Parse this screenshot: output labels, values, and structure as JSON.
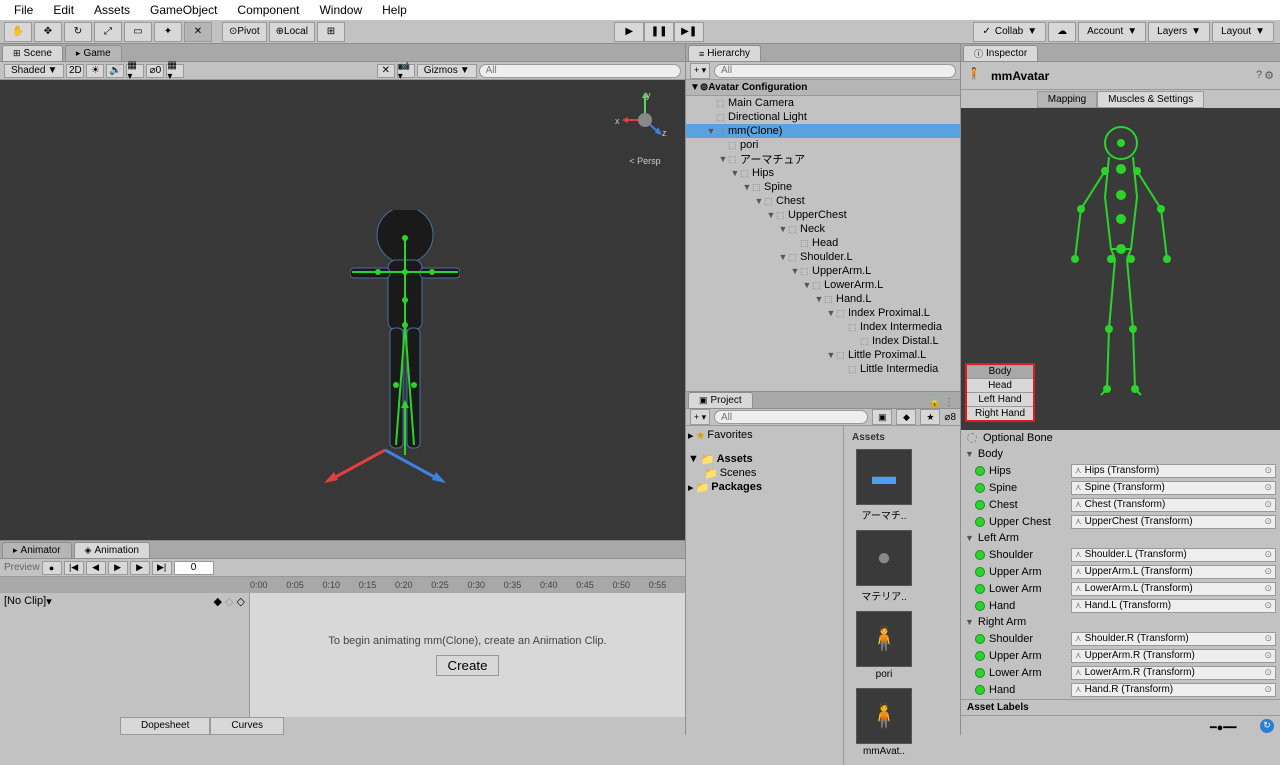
{
  "menu": {
    "file": "File",
    "edit": "Edit",
    "assets": "Assets",
    "gameObject": "GameObject",
    "component": "Component",
    "window": "Window",
    "help": "Help"
  },
  "toolbar": {
    "pivot": "Pivot",
    "local": "Local",
    "collab": "Collab",
    "account": "Account",
    "layers": "Layers",
    "layout": "Layout"
  },
  "tabs": {
    "scene": "Scene",
    "game": "Game",
    "hierarchy": "Hierarchy",
    "project": "Project",
    "inspector": "Inspector",
    "animator": "Animator",
    "animation": "Animation"
  },
  "sceneHdr": {
    "shaded": "Shaded",
    "mode2d": "2D",
    "gizmos": "Gizmos",
    "allPlaceholder": "All",
    "persp": "Persp",
    "x": "x",
    "y": "y",
    "z": "z"
  },
  "hier": {
    "section": "Avatar Configuration",
    "items": [
      {
        "l": 1,
        "n": "Main Camera"
      },
      {
        "l": 1,
        "n": "Directional Light"
      },
      {
        "l": 1,
        "n": "mm(Clone)",
        "f": true,
        "sel": true
      },
      {
        "l": 2,
        "n": "pori"
      },
      {
        "l": 2,
        "n": "アーマチュア",
        "f": true
      },
      {
        "l": 3,
        "n": "Hips",
        "f": true
      },
      {
        "l": 4,
        "n": "Spine",
        "f": true
      },
      {
        "l": 5,
        "n": "Chest",
        "f": true
      },
      {
        "l": 6,
        "n": "UpperChest",
        "f": true
      },
      {
        "l": 7,
        "n": "Neck",
        "f": true
      },
      {
        "l": 8,
        "n": "Head"
      },
      {
        "l": 7,
        "n": "Shoulder.L",
        "f": true
      },
      {
        "l": 8,
        "n": "UpperArm.L",
        "f": true
      },
      {
        "l": 9,
        "n": "LowerArm.L",
        "f": true
      },
      {
        "l": 10,
        "n": "Hand.L",
        "f": true
      },
      {
        "l": 11,
        "n": "Index Proximal.L",
        "f": true
      },
      {
        "l": 12,
        "n": "Index Intermedia"
      },
      {
        "l": 13,
        "n": "Index Distal.L"
      },
      {
        "l": 11,
        "n": "Little Proximal.L",
        "f": true
      },
      {
        "l": 12,
        "n": "Little Intermedia"
      }
    ]
  },
  "project": {
    "allPlaceholder": "All",
    "count": "8",
    "favorites": "Favorites",
    "assets": "Assets",
    "scenes": "Scenes",
    "packages": "Packages",
    "gridHdr": "Assets",
    "items": [
      "アーマチ..",
      "マテリア..",
      "pori",
      "mmAvat.."
    ]
  },
  "anim": {
    "preview": "Preview",
    "frame": "0",
    "noclip": "[No Clip]",
    "ticks": [
      "0:00",
      "0:05",
      "0:10",
      "0:15",
      "0:20",
      "0:25",
      "0:30",
      "0:35",
      "0:40",
      "0:45",
      "0:50",
      "0:55"
    ],
    "msg": "To begin animating mm(Clone), create an Animation Clip.",
    "create": "Create",
    "dopesheet": "Dopesheet",
    "curves": "Curves"
  },
  "insp": {
    "name": "mmAvatar",
    "mapping": "Mapping",
    "muscles": "Muscles & Settings",
    "bodyTabs": [
      "Body",
      "Head",
      "Left Hand",
      "Right Hand"
    ],
    "optional": "Optional Bone",
    "sections": [
      {
        "name": "Body",
        "bones": [
          {
            "n": "Hips",
            "t": "Hips (Transform)"
          },
          {
            "n": "Spine",
            "t": "Spine (Transform)"
          },
          {
            "n": "Chest",
            "t": "Chest (Transform)"
          },
          {
            "n": "Upper Chest",
            "t": "UpperChest (Transform)"
          }
        ]
      },
      {
        "name": "Left Arm",
        "bones": [
          {
            "n": "Shoulder",
            "t": "Shoulder.L (Transform)"
          },
          {
            "n": "Upper Arm",
            "t": "UpperArm.L (Transform)"
          },
          {
            "n": "Lower Arm",
            "t": "LowerArm.L (Transform)"
          },
          {
            "n": "Hand",
            "t": "Hand.L (Transform)"
          }
        ]
      },
      {
        "name": "Right Arm",
        "bones": [
          {
            "n": "Shoulder",
            "t": "Shoulder.R (Transform)"
          },
          {
            "n": "Upper Arm",
            "t": "UpperArm.R (Transform)"
          },
          {
            "n": "Lower Arm",
            "t": "LowerArm.R (Transform)"
          },
          {
            "n": "Hand",
            "t": "Hand.R (Transform)"
          }
        ]
      }
    ],
    "assetLabels": "Asset Labels"
  }
}
